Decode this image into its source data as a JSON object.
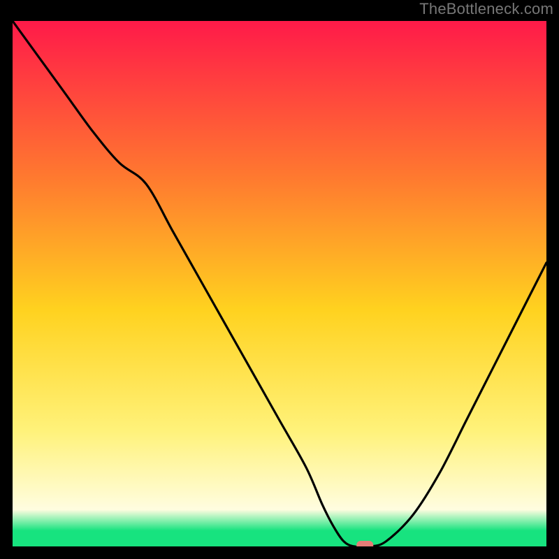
{
  "watermark": "TheBottleneck.com",
  "colors": {
    "bg": "#000000",
    "grad_top": "#ff1a49",
    "grad_mid_upper": "#ff7a2f",
    "grad_mid": "#ffd21f",
    "grad_mid_lower": "#fff27a",
    "grad_low_yellow": "#fffde0",
    "grad_green": "#17e37f",
    "curve": "#000000",
    "marker": "#e77c77"
  },
  "chart_data": {
    "type": "line",
    "title": "",
    "xlabel": "",
    "ylabel": "",
    "xlim": [
      0,
      100
    ],
    "ylim": [
      0,
      100
    ],
    "x": [
      0,
      5,
      10,
      15,
      20,
      25,
      30,
      35,
      40,
      45,
      50,
      55,
      58,
      60,
      62,
      64,
      67,
      70,
      75,
      80,
      85,
      90,
      95,
      100
    ],
    "values": [
      100,
      93,
      86,
      79,
      73,
      69,
      60,
      51,
      42,
      33,
      24,
      15,
      8,
      4,
      1,
      0,
      0,
      1,
      6,
      14,
      24,
      34,
      44,
      54
    ],
    "marker": {
      "x": 66,
      "y": 0
    },
    "notes": "Single V-shaped curve against a vertical red→green gradient background; minimum near x≈65, right branch rises to ≈54 at x=100. No axis ticks or labels shown."
  }
}
